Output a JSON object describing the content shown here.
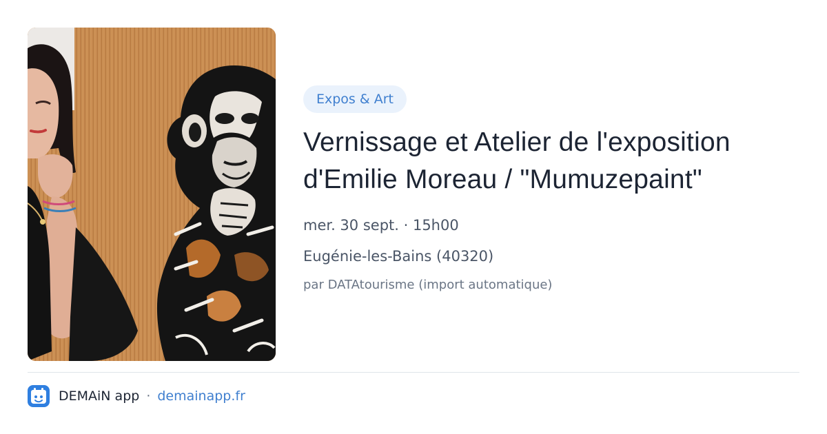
{
  "event": {
    "category": "Expos & Art",
    "title": "Vernissage et Atelier de l'exposition d'Emilie Moreau / \"Mumuzepaint\"",
    "datetime": "mer. 30 sept. · 15h00",
    "location": "Eugénie-les-Bains (40320)",
    "source": "par DATAtourisme (import automatique)"
  },
  "footer": {
    "app_name": "DEMAiN app",
    "separator": "·",
    "domain": "demainapp.fr",
    "icon": "demain-app-logo-icon"
  },
  "colors": {
    "accent": "#3f7fcf",
    "badge_bg": "#eaf2fc",
    "title": "#1c2433",
    "muted": "#6a7585",
    "divider": "#dfe5ea"
  }
}
